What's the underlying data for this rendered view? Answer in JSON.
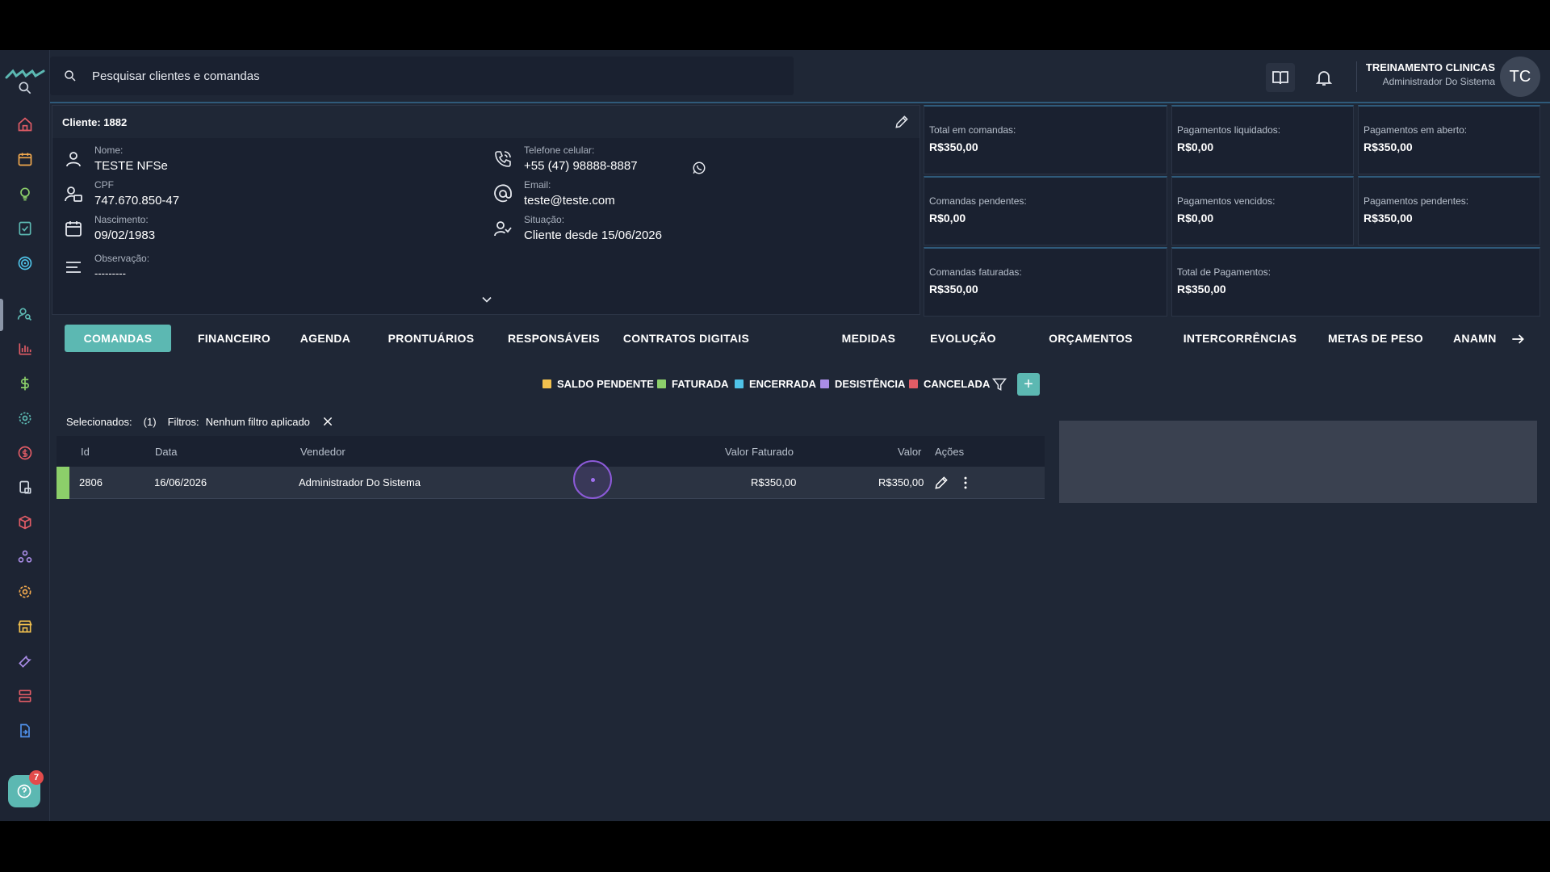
{
  "search": {
    "placeholder": "Pesquisar clientes e comandas"
  },
  "user": {
    "name": "TREINAMENTO CLINICAS",
    "role": "Administrador Do Sistema",
    "initials": "TC"
  },
  "help": {
    "badge": "7"
  },
  "client": {
    "title": "Cliente: 1882",
    "nome_label": "Nome:",
    "nome": "TESTE NFSe",
    "cpf_label": "CPF",
    "cpf": "747.670.850-47",
    "nasc_label": "Nascimento:",
    "nasc": "09/02/1983",
    "obs_label": "Observação:",
    "obs": "---------",
    "tel_label": "Telefone celular:",
    "tel": "+55 (47) 98888-8887",
    "email_label": "Email:",
    "email": "teste@teste.com",
    "sit_label": "Situação:",
    "sit": "Cliente desde 15/06/2026"
  },
  "stats": {
    "total_comandas": {
      "label": "Total em comandas:",
      "value": "R$350,00"
    },
    "pag_liquidados": {
      "label": "Pagamentos liquidados:",
      "value": "R$0,00"
    },
    "pag_aberto": {
      "label": "Pagamentos em aberto:",
      "value": "R$350,00"
    },
    "comandas_pendentes": {
      "label": "Comandas pendentes:",
      "value": "R$0,00"
    },
    "pag_vencidos": {
      "label": "Pagamentos vencidos:",
      "value": "R$0,00"
    },
    "pag_pendentes": {
      "label": "Pagamentos pendentes:",
      "value": "R$350,00"
    },
    "comandas_faturadas": {
      "label": "Comandas faturadas:",
      "value": "R$350,00"
    },
    "total_pagamentos": {
      "label": "Total de Pagamentos:",
      "value": "R$350,00"
    }
  },
  "tabs": [
    "COMANDAS",
    "FINANCEIRO",
    "AGENDA",
    "PRONTUÁRIOS",
    "RESPONSÁVEIS",
    "CONTRATOS DIGITAIS",
    "MEDIDAS",
    "EVOLUÇÃO",
    "ORÇAMENTOS",
    "INTERCORRÊNCIAS",
    "METAS DE PESO",
    "ANAMN"
  ],
  "legend": [
    {
      "label": "SALDO PENDENTE",
      "color": "#f2c14e"
    },
    {
      "label": "FATURADA",
      "color": "#8ccf6a"
    },
    {
      "label": "ENCERRADA",
      "color": "#4fc3e8"
    },
    {
      "label": "DESISTÊNCIA",
      "color": "#a98ce6"
    },
    {
      "label": "CANCELADA",
      "color": "#e25c66"
    }
  ],
  "selection": {
    "label": "Selecionados:",
    "count": "(1)",
    "filters_label": "Filtros:",
    "filters_value": "Nenhum filtro aplicado"
  },
  "table": {
    "headers": {
      "id": "Id",
      "data": "Data",
      "vendedor": "Vendedor",
      "valor_faturado": "Valor Faturado",
      "valor": "Valor",
      "acoes": "Ações"
    },
    "rows": [
      {
        "id": "2806",
        "data": "16/06/2026",
        "vendedor": "Administrador Do Sistema",
        "valor_faturado": "R$350,00",
        "valor": "R$350,00",
        "status_color": "#8ccf6a"
      }
    ]
  },
  "colors": {
    "accent": "#5cb8b2",
    "badge": "#e24b4b"
  }
}
